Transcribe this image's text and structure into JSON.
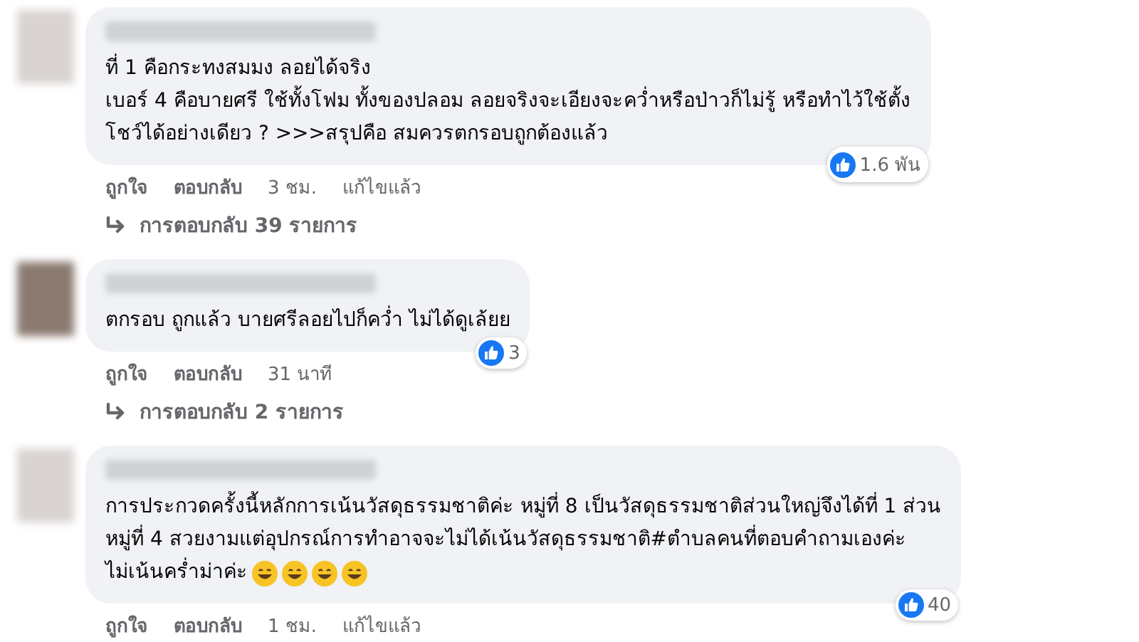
{
  "comments": [
    {
      "lines": [
        "ที่ 1 คือกระทงสมมง ลอยได้จริง",
        "เบอร์ 4 คือบายศรี ใช้ทั้งโฟม ทั้งของปลอม ลอยจริงจะเอียงจะคว่ำหรือป่าวก็ไม่รู้ หรือทำไว้ใช้ตั้ง",
        "โชว์ได้อย่างเดียว ? >>>สรุปคือ สมควรตกรอบถูกต้องแล้ว"
      ],
      "reactions": "1.6 พัน",
      "actions": [
        "ถูกใจ",
        "ตอบกลับ",
        "3 ชม.",
        "แก้ไขแล้ว"
      ],
      "replies": "การตอบกลับ 39 รายการ"
    },
    {
      "lines": [
        "ตกรอบ ถูกแล้ว บายศรีลอยไปก็คว่ำ ไม่ได้ดูเล้ยย"
      ],
      "reactions": "3",
      "actions": [
        "ถูกใจ",
        "ตอบกลับ",
        "31 นาที"
      ],
      "replies": "การตอบกลับ 2 รายการ"
    },
    {
      "lines": [
        "การประกวดครั้งนี้หลักการเน้นวัสดุธรรมชาติค่ะ หมู่ที่ 8 เป็นวัสดุธรรมชาติส่วนใหญ่จึงได้ที่ 1 ส่วน",
        "หมู่ที่ 4 สวยงามแต่อุปกรณ์การทำอาจจะไม่ได้เน้นวัสดุธรรมชาติ#ตำบลคนที่ตอบคำถามเองค่ะ",
        "ไม่เน้นคร่ำม่าค่ะ"
      ],
      "emojis": [
        {
          "kind": "grin"
        },
        {
          "kind": "grin"
        },
        {
          "kind": "grin"
        },
        {
          "kind": "grin"
        }
      ],
      "reactions": "40",
      "actions": [
        "ถูกใจ",
        "ตอบกลับ",
        "1 ชม.",
        "แก้ไขแล้ว"
      ]
    }
  ]
}
